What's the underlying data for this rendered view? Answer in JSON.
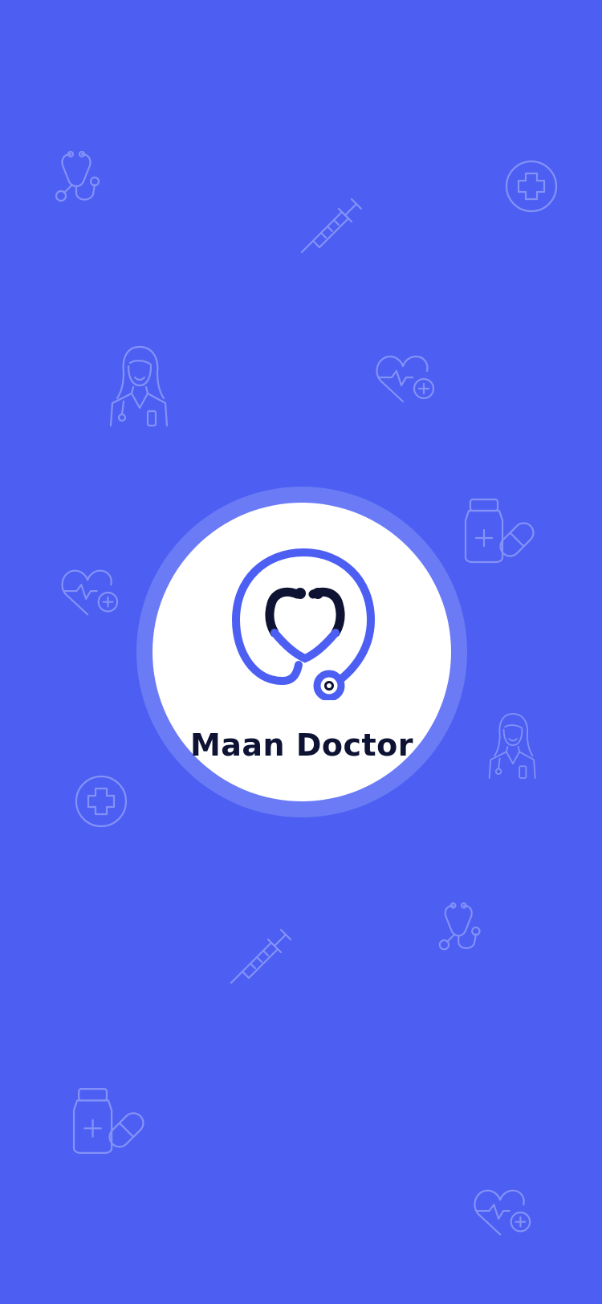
{
  "app": {
    "name": "Maan Doctor"
  },
  "theme": {
    "background": "#4C5FF2",
    "ring": "#6A7BF5",
    "logo_blue": "#4C5FF2",
    "logo_dark": "#0E1233",
    "icon_outline": "#C9D0FF"
  },
  "logo": {
    "icon": "stethoscope-logo-icon"
  },
  "background_icons": [
    "stethoscope-icon",
    "syringe-icon",
    "medical-cross-icon",
    "female-doctor-icon",
    "heart-plus-icon",
    "medicine-bottle-icon",
    "heart-plus-icon",
    "female-doctor-icon",
    "medical-cross-icon",
    "syringe-icon",
    "stethoscope-icon",
    "medicine-bottle-icon",
    "heart-plus-icon"
  ]
}
